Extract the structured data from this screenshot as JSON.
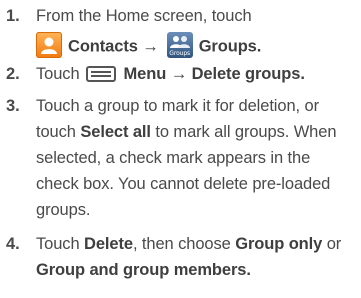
{
  "steps": [
    {
      "number": "1.",
      "line1": "From the Home screen, touch",
      "contacts_label": "Contacts",
      "arrow": "→",
      "groups_label": "Groups",
      "groups_icon_text": "Groups",
      "period": "."
    },
    {
      "number": "2.",
      "touch": "Touch",
      "menu_label": "Menu",
      "arrow": "→",
      "action": "Delete groups",
      "period": "."
    },
    {
      "number": "3.",
      "line1_a": "Touch a group to mark it for deletion, or",
      "line2_a": "touch ",
      "select_all": "Select all",
      "line2_b": " to mark all groups. When",
      "line3": "selected, a check mark appears in the",
      "line4": "check box. You cannot delete pre-loaded",
      "line5": "groups."
    },
    {
      "number": "4.",
      "line1_a": "Touch ",
      "delete": "Delete",
      "line1_b": ", then choose ",
      "group_only": "Group only",
      "line1_c": " or",
      "group_and_members": "Group and group members",
      "period": "."
    }
  ],
  "icons": {
    "contacts": "contacts-icon",
    "groups": "groups-icon",
    "menu": "menu-key-icon"
  },
  "colors": {
    "text": "#4a4a4a",
    "contacts_icon": "#f07a10",
    "groups_icon": "#2f557f"
  }
}
